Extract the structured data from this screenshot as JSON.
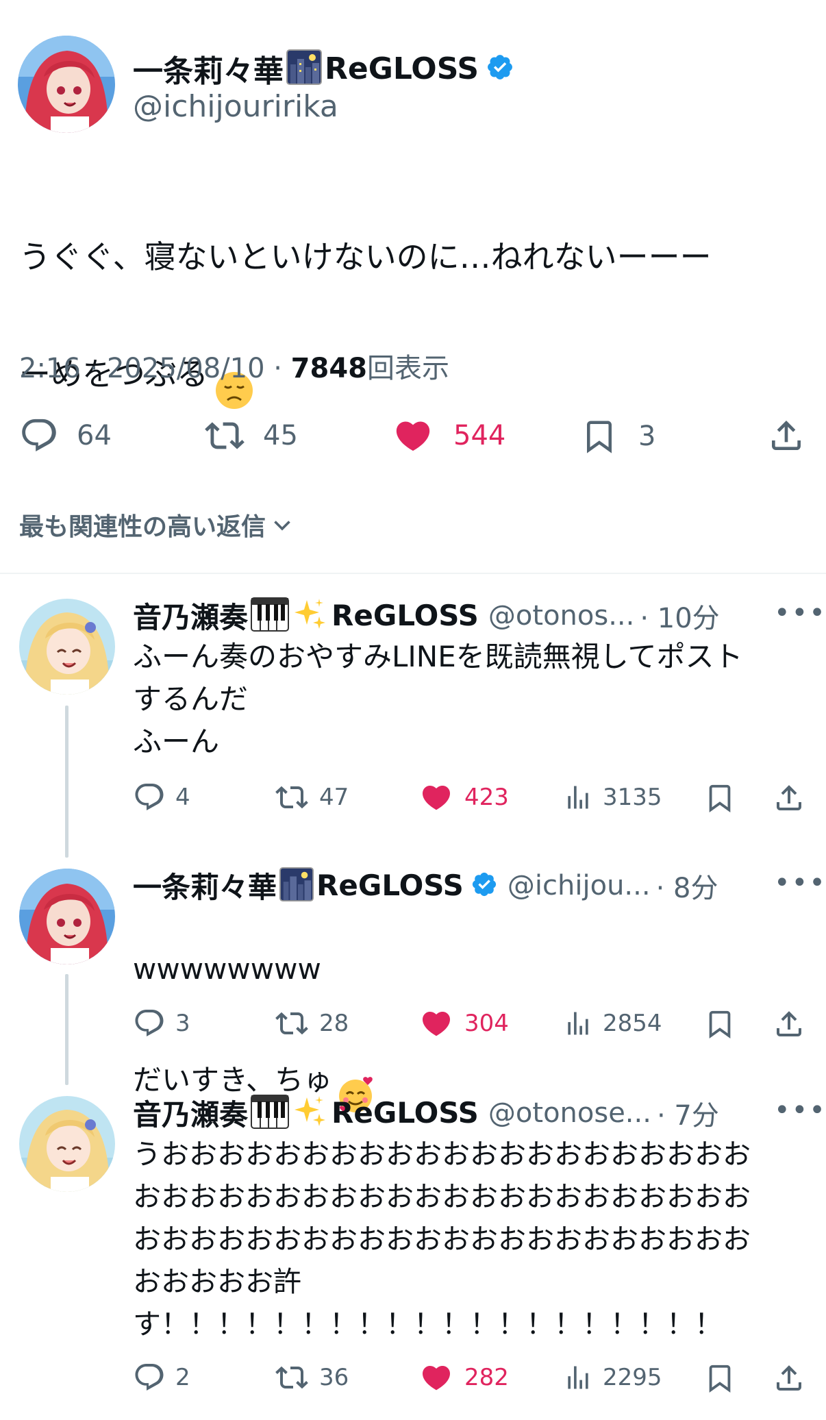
{
  "main": {
    "name": "一条莉々華",
    "group": "ReGLOSS",
    "handle": "@ichijouririka",
    "text_line1": "うぐぐ、寝ないといけないのに…ねれないーーー",
    "text_line2": "ーめをつぶる",
    "time": "2:16 · 2025/08/10 · ",
    "views_count": "7848",
    "views_label": "回表示",
    "replies": "64",
    "retweets": "45",
    "likes": "544",
    "bookmarks": "3",
    "sort_label": "最も関連性の高い返信"
  },
  "replies": [
    {
      "name": "音乃瀬奏",
      "group": "ReGLOSS",
      "handle": "@otonos...",
      "time": "· 10分",
      "text": "ふーん奏のおやすみLINEを既読無視してポスト\nするんだ\nふーん",
      "replies": "4",
      "retweets": "47",
      "likes": "423",
      "views": "3135"
    },
    {
      "name": "一条莉々華",
      "group": "ReGLOSS",
      "handle": "@ichijou...",
      "time": "· 8分",
      "text_line1": "wwwwwwww",
      "text_line2": "だいすき、ちゅ",
      "replies": "3",
      "retweets": "28",
      "likes": "304",
      "views": "2854"
    },
    {
      "name": "音乃瀬奏",
      "group": "ReGLOSS",
      "handle": "@otonose...",
      "time": "· 7分",
      "text": "うおおおおおおおおおおおおおおおおおおおおお\nおおおおおおおおおおおおおおおおおおおおおお\nおおおおおおおおおおおおおおおおおおおおおお\nおおおおお許\nす！！！！！！！！！！！！！！！！！！！！",
      "replies": "2",
      "retweets": "36",
      "likes": "282",
      "views": "2295"
    }
  ],
  "colors": {
    "like_pink": "#e0245e",
    "secondary": "#536471",
    "verified_blue": "#1d9bf0"
  }
}
